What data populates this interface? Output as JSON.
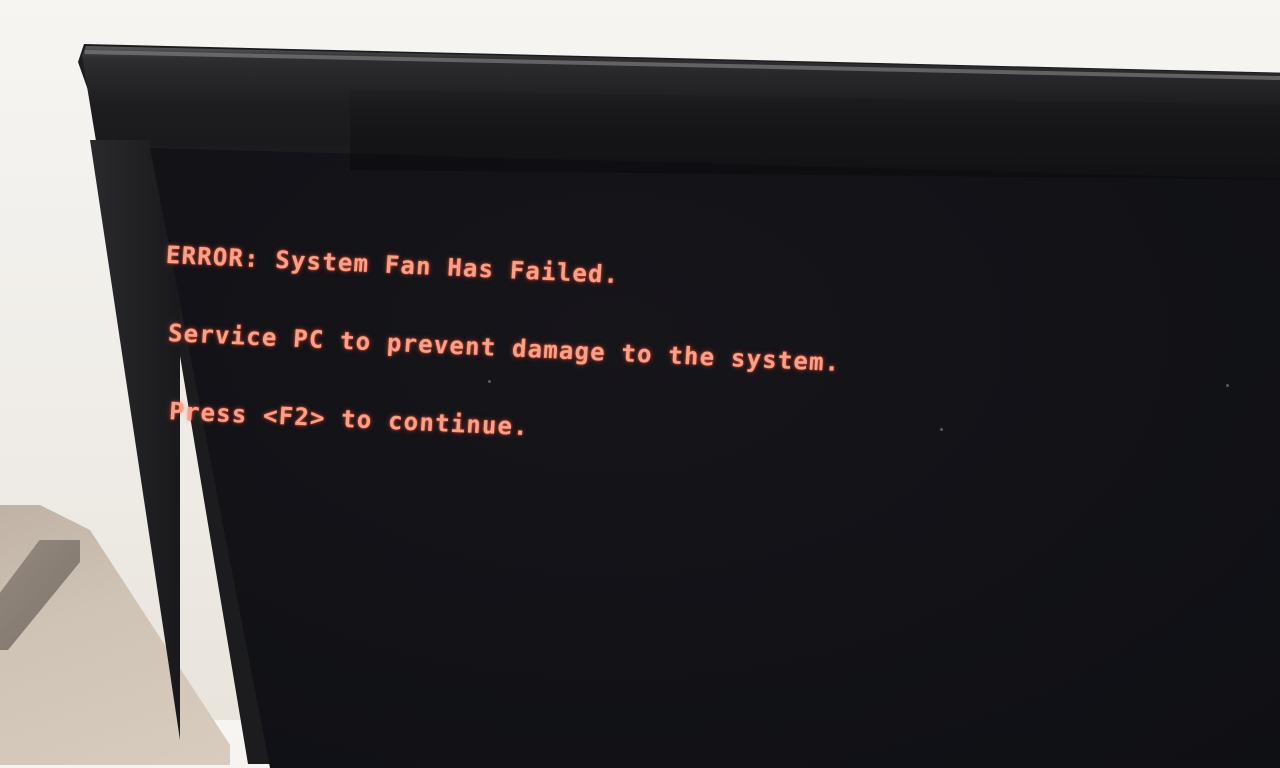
{
  "scene": {
    "description": "Photo of a monitor displaying a BIOS POST error message",
    "colors": {
      "error_text": "#f7a08a",
      "screen_bg": "#121217",
      "bezel": "#1c1c1f",
      "wall": "#f6f5f2"
    }
  },
  "bios_message": {
    "lines": [
      "ERROR: System Fan Has Failed.",
      "Service PC to prevent damage to the system.",
      "Press <F2> to continue."
    ],
    "continue_key": "F2"
  }
}
